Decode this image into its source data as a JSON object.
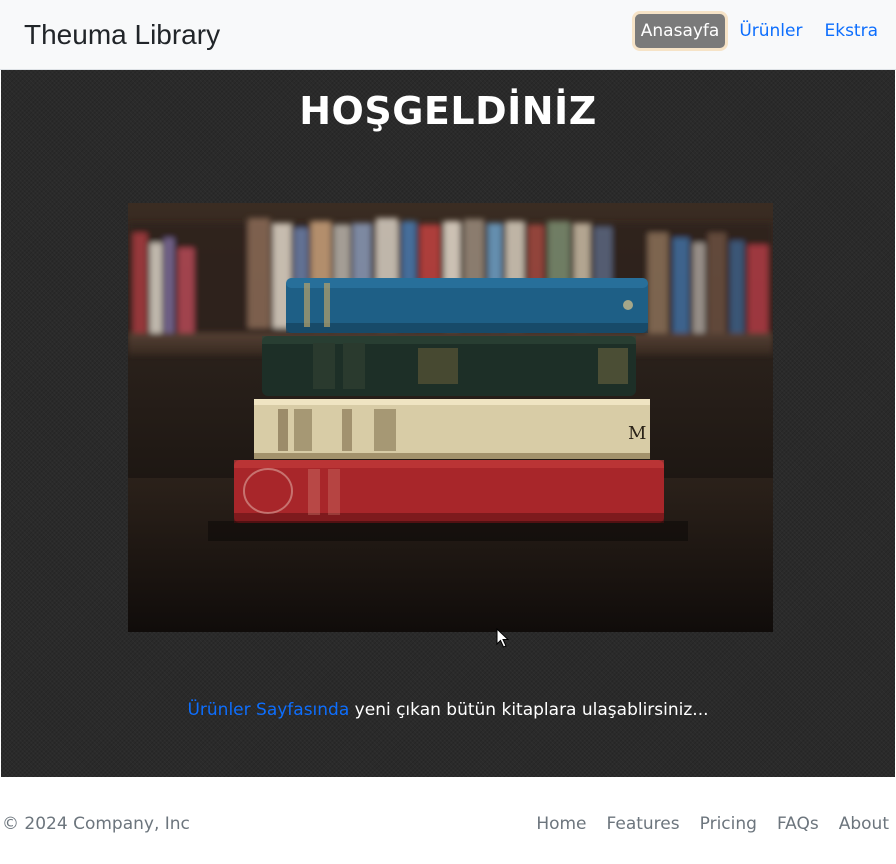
{
  "navbar": {
    "brand": "Theuma Library",
    "links": [
      {
        "label": "Anasayfa",
        "active": true
      },
      {
        "label": "Ürünler",
        "active": false
      },
      {
        "label": "Ekstra",
        "active": false
      }
    ]
  },
  "hero": {
    "title": "HOŞGELDİNİZ",
    "image_alt": "stack-of-books-photo",
    "tagline_link": "Ürünler Sayfasında",
    "tagline_text": " yeni çıkan bütün kitaplara ulaşablirsiniz..."
  },
  "footer": {
    "copyright": "© 2024 Company, Inc",
    "links": [
      "Home",
      "Features",
      "Pricing",
      "FAQs",
      "About"
    ]
  },
  "colors": {
    "accent": "#0d6efd",
    "active_nav_bg": "#7a7a7a",
    "main_bg": "#2a2a2a",
    "muted_text": "#6c757d"
  }
}
